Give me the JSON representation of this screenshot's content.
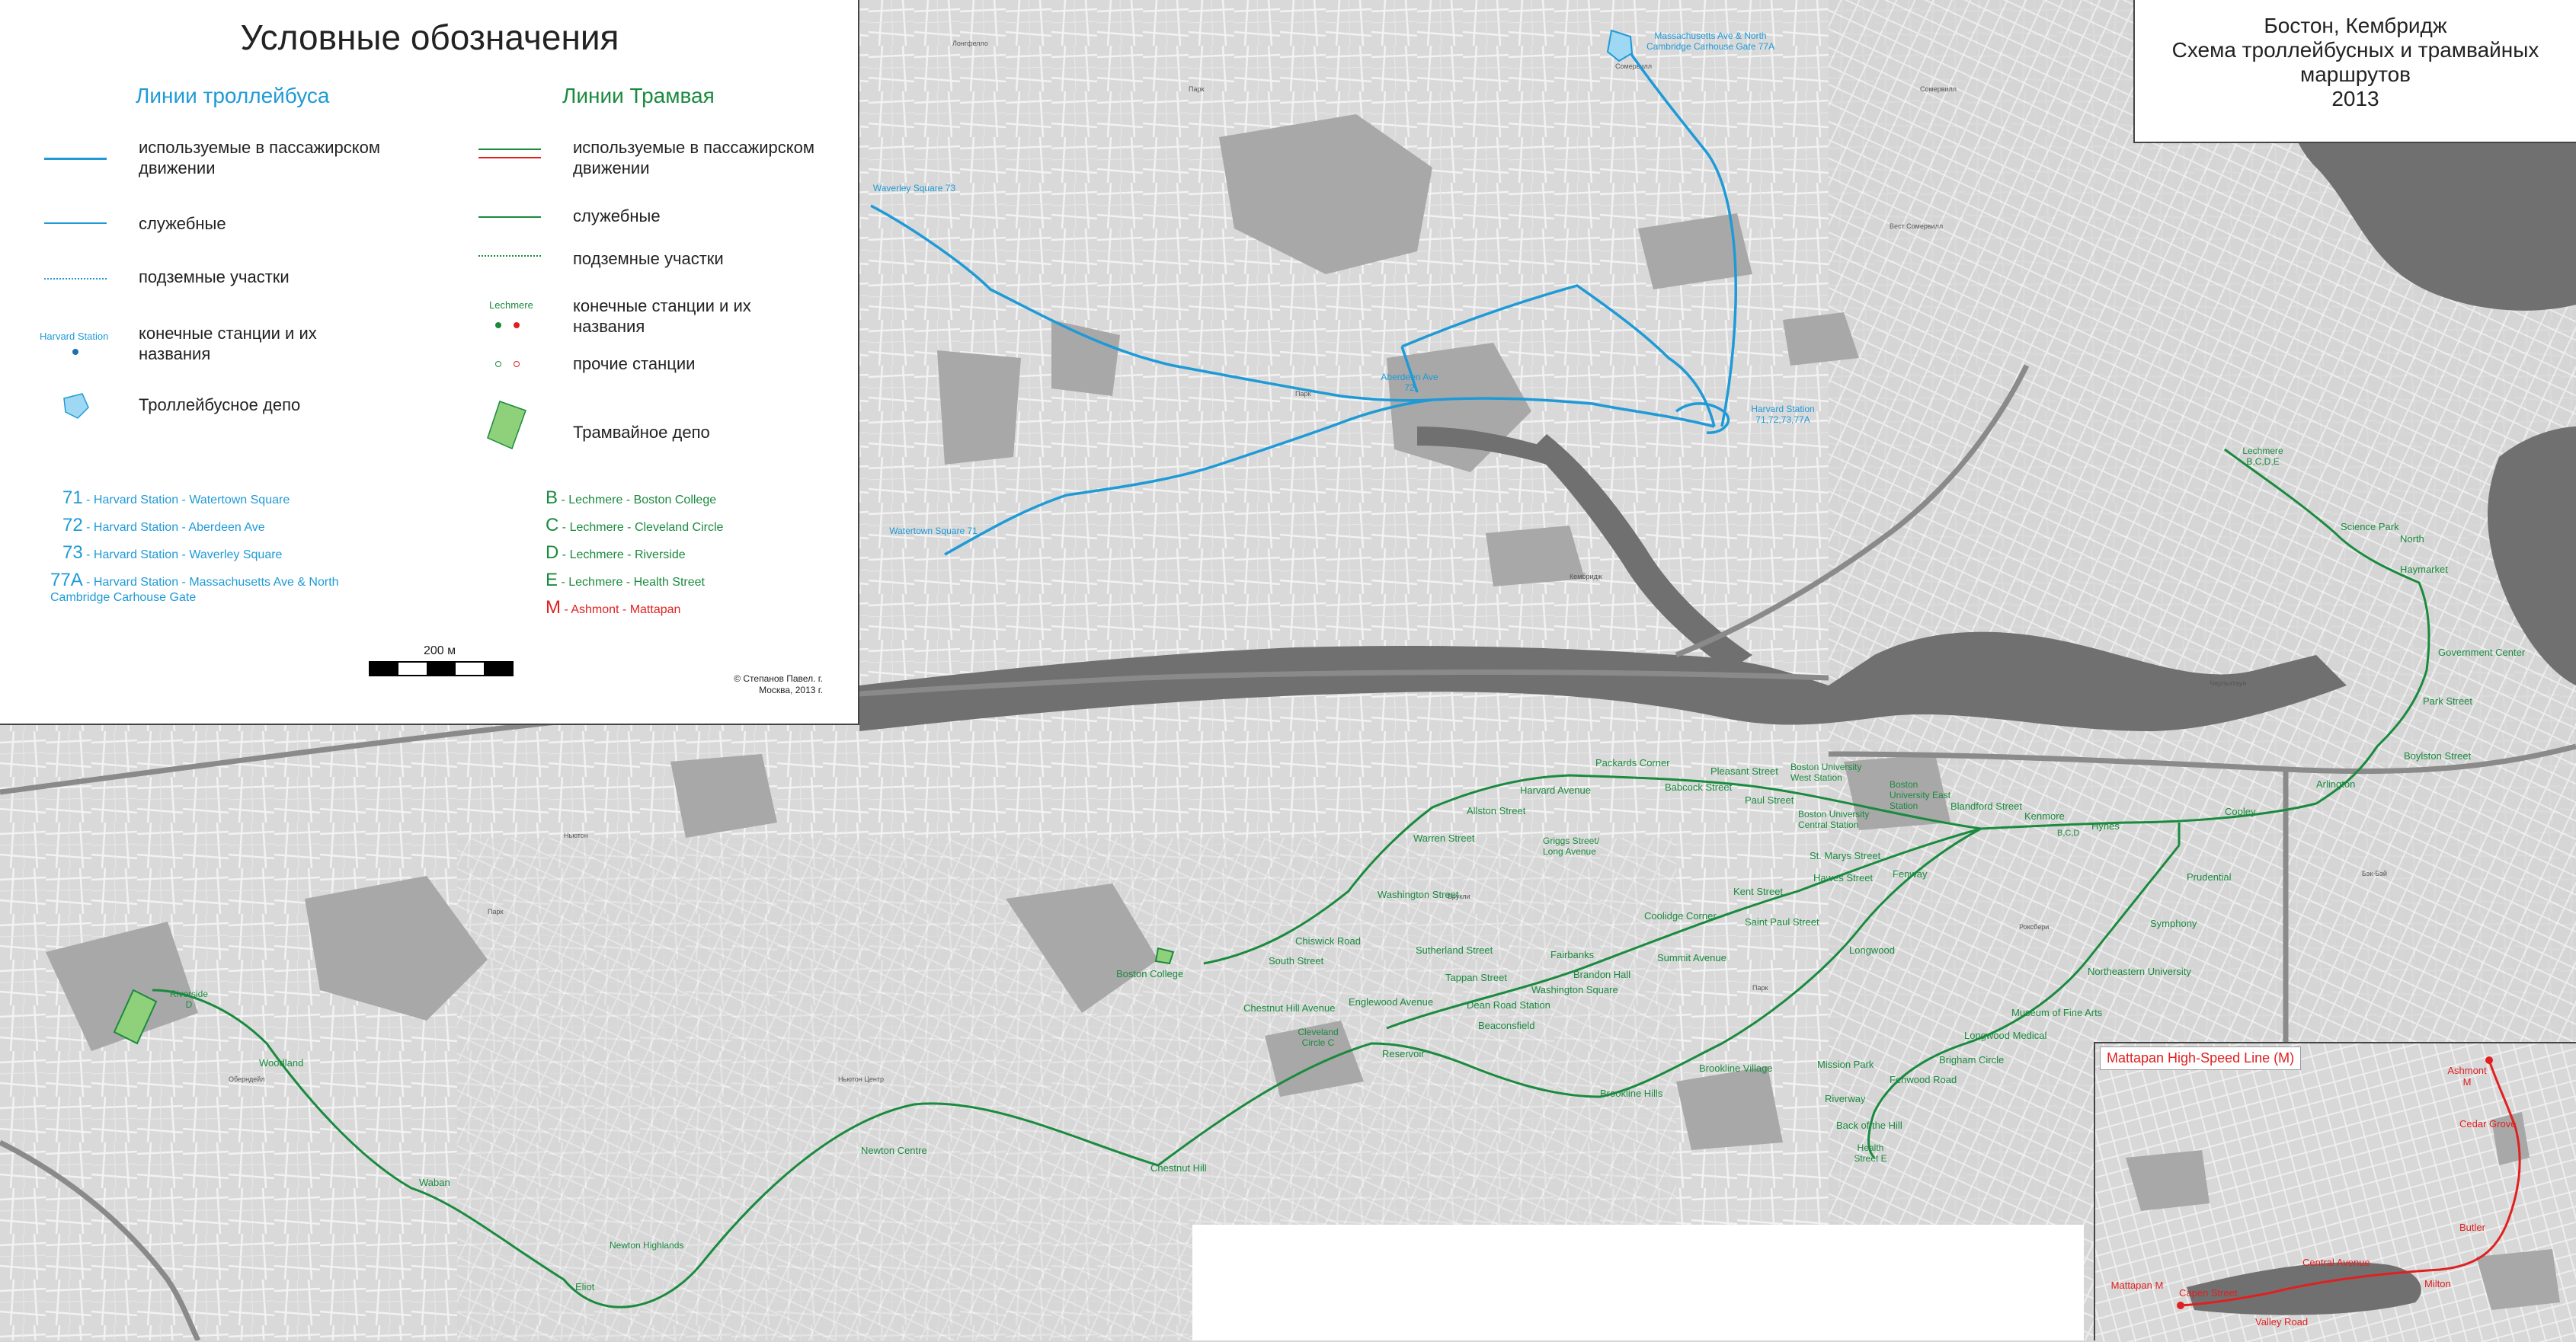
{
  "legend": {
    "title": "Условные обозначения",
    "trolley_head": "Линии троллейбуса",
    "tram_head": "Линии Трамвая",
    "passenger": "используемые в пассажирском движении",
    "service": "служебные",
    "underground": "подземные участки",
    "terminals": "конечные станции и их названия",
    "other_stations": "прочие станции",
    "trolley_depot": "Троллейбусное депо",
    "tram_depot": "Трамвайное депо",
    "sample_trolley_station": "Harvard Station",
    "sample_tram_station": "Lechmere",
    "trolley_routes": [
      {
        "num": "71",
        "text": "- Harvard Station - Watertown Square"
      },
      {
        "num": "72",
        "text": "- Harvard Station - Aberdeen Ave"
      },
      {
        "num": "73",
        "text": "- Harvard Station - Waverley Square"
      },
      {
        "num": "77A",
        "text": "- Harvard Station - Massachusetts Ave & North Cambridge Carhouse Gate"
      }
    ],
    "tram_routes": [
      {
        "num": "B",
        "text": "- Lechmere - Boston College"
      },
      {
        "num": "C",
        "text": "- Lechmere - Cleveland Circle"
      },
      {
        "num": "D",
        "text": "- Lechmere - Riverside"
      },
      {
        "num": "E",
        "text": "- Lechmere - Health Street"
      },
      {
        "num": "M",
        "text": "- Ashmont - Mattapan"
      }
    ],
    "scale_label": "200 м",
    "copyright": "© Степанов Павел. г. Москва, 2013 г."
  },
  "title": {
    "line1": "Бостон, Кембридж",
    "line2": "Схема троллейбусных и трамвайных",
    "line3": "маршрутов",
    "year": "2013"
  },
  "colors": {
    "trolley": "#1f9ad6",
    "tram": "#1a8a3e",
    "mattapan": "#e02020",
    "land": "#d6d6d6",
    "water": "#6e6e6e",
    "park": "#9a9a9a"
  },
  "inset": {
    "title": "Mattapan High-Speed Line (M)"
  },
  "trolley_labels": [
    {
      "id": "t-gate",
      "text": "Massachusetts Ave & North Cambridge Carhouse Gate 77A"
    },
    {
      "id": "t-waverley",
      "text": "Waverley Square 73"
    },
    {
      "id": "t-aberdeen",
      "text": "Aberdeen Ave 72"
    },
    {
      "id": "t-harvard",
      "text": "Harvard Station 71,72,73,77A"
    },
    {
      "id": "t-watertown",
      "text": "Watertown Square 71"
    }
  ],
  "tram_labels": [
    {
      "id": "s1",
      "text": "Lechmere B,C,D,E"
    },
    {
      "id": "s2",
      "text": "Science Park"
    },
    {
      "id": "s3",
      "text": "North"
    },
    {
      "id": "s4",
      "text": "Haymarket"
    },
    {
      "id": "s5",
      "text": "Government Center"
    },
    {
      "id": "s6",
      "text": "Park Street"
    },
    {
      "id": "s7",
      "text": "Boylston Street"
    },
    {
      "id": "s8",
      "text": "Arlington"
    },
    {
      "id": "s9",
      "text": "Copley"
    },
    {
      "id": "s10",
      "text": "Hynes"
    },
    {
      "id": "s11",
      "text": "Kenmore"
    },
    {
      "id": "s12",
      "text": "B,C,D"
    },
    {
      "id": "s13",
      "text": "Blandford Street"
    },
    {
      "id": "s14",
      "text": "Boston University East Station"
    },
    {
      "id": "s15",
      "text": "Boston University Central Station"
    },
    {
      "id": "s16",
      "text": "Boston University West Station"
    },
    {
      "id": "s17",
      "text": "Pleasant Street"
    },
    {
      "id": "s18",
      "text": "Packards Corner"
    },
    {
      "id": "s19",
      "text": "Babcock Street"
    },
    {
      "id": "s20",
      "text": "Paul Street"
    },
    {
      "id": "s21",
      "text": "Harvard Avenue"
    },
    {
      "id": "s22",
      "text": "Allston Street"
    },
    {
      "id": "s23",
      "text": "Griggs Street/ Long Avenue"
    },
    {
      "id": "s24",
      "text": "Warren Street"
    },
    {
      "id": "s25",
      "text": "St. Marys Street"
    },
    {
      "id": "s26",
      "text": "Hawes Street"
    },
    {
      "id": "s27",
      "text": "Kent Street"
    },
    {
      "id": "s28",
      "text": "Saint Paul Street"
    },
    {
      "id": "s29",
      "text": "Coolidge Corner"
    },
    {
      "id": "s30",
      "text": "Summit Avenue"
    },
    {
      "id": "s31",
      "text": "Brandon Hall"
    },
    {
      "id": "s32",
      "text": "Fairbanks"
    },
    {
      "id": "s33",
      "text": "Washington Square"
    },
    {
      "id": "s34",
      "text": "Tappan Street"
    },
    {
      "id": "s35",
      "text": "Dean Road Station"
    },
    {
      "id": "s36",
      "text": "Beaconsfield"
    },
    {
      "id": "s37",
      "text": "Englewood Avenue"
    },
    {
      "id": "s38",
      "text": "Sutherland Street"
    },
    {
      "id": "s39",
      "text": "Washington Street"
    },
    {
      "id": "s40",
      "text": "Chiswick Road"
    },
    {
      "id": "s41",
      "text": "South Street"
    },
    {
      "id": "s42",
      "text": "Boston College"
    },
    {
      "id": "s43",
      "text": "Chestnut Hill Avenue"
    },
    {
      "id": "s44",
      "text": "Cleveland Circle C"
    },
    {
      "id": "s45",
      "text": "Reservoir"
    },
    {
      "id": "s46",
      "text": "Fenway"
    },
    {
      "id": "s47",
      "text": "Longwood"
    },
    {
      "id": "s48",
      "text": "Brookline Village"
    },
    {
      "id": "s49",
      "text": "Brookline Hills"
    },
    {
      "id": "s50",
      "text": "Chestnut Hill"
    },
    {
      "id": "s51",
      "text": "Newton Centre"
    },
    {
      "id": "s52",
      "text": "Newton Highlands"
    },
    {
      "id": "s53",
      "text": "Eliot"
    },
    {
      "id": "s54",
      "text": "Waban"
    },
    {
      "id": "s55",
      "text": "Woodland"
    },
    {
      "id": "s56",
      "text": "Riverside D"
    },
    {
      "id": "s57",
      "text": "Prudential"
    },
    {
      "id": "s58",
      "text": "Symphony"
    },
    {
      "id": "s59",
      "text": "Northeastern University"
    },
    {
      "id": "s60",
      "text": "Museum of Fine Arts"
    },
    {
      "id": "s61",
      "text": "Longwood Medical"
    },
    {
      "id": "s62",
      "text": "Brigham Circle"
    },
    {
      "id": "s63",
      "text": "Fenwood Road"
    },
    {
      "id": "s64",
      "text": "Mission Park"
    },
    {
      "id": "s65",
      "text": "Riverway"
    },
    {
      "id": "s66",
      "text": "Back of the Hill"
    },
    {
      "id": "s67",
      "text": "Health Street E"
    }
  ],
  "mattapan_labels": [
    {
      "id": "m1",
      "text": "Ashmont M"
    },
    {
      "id": "m2",
      "text": "Cedar Grove"
    },
    {
      "id": "m3",
      "text": "Butler"
    },
    {
      "id": "m4",
      "text": "Milton"
    },
    {
      "id": "m5",
      "text": "Central Avenue"
    },
    {
      "id": "m6",
      "text": "Valley Road"
    },
    {
      "id": "m7",
      "text": "Capen Street"
    },
    {
      "id": "m8",
      "text": "Mattapan M"
    }
  ]
}
